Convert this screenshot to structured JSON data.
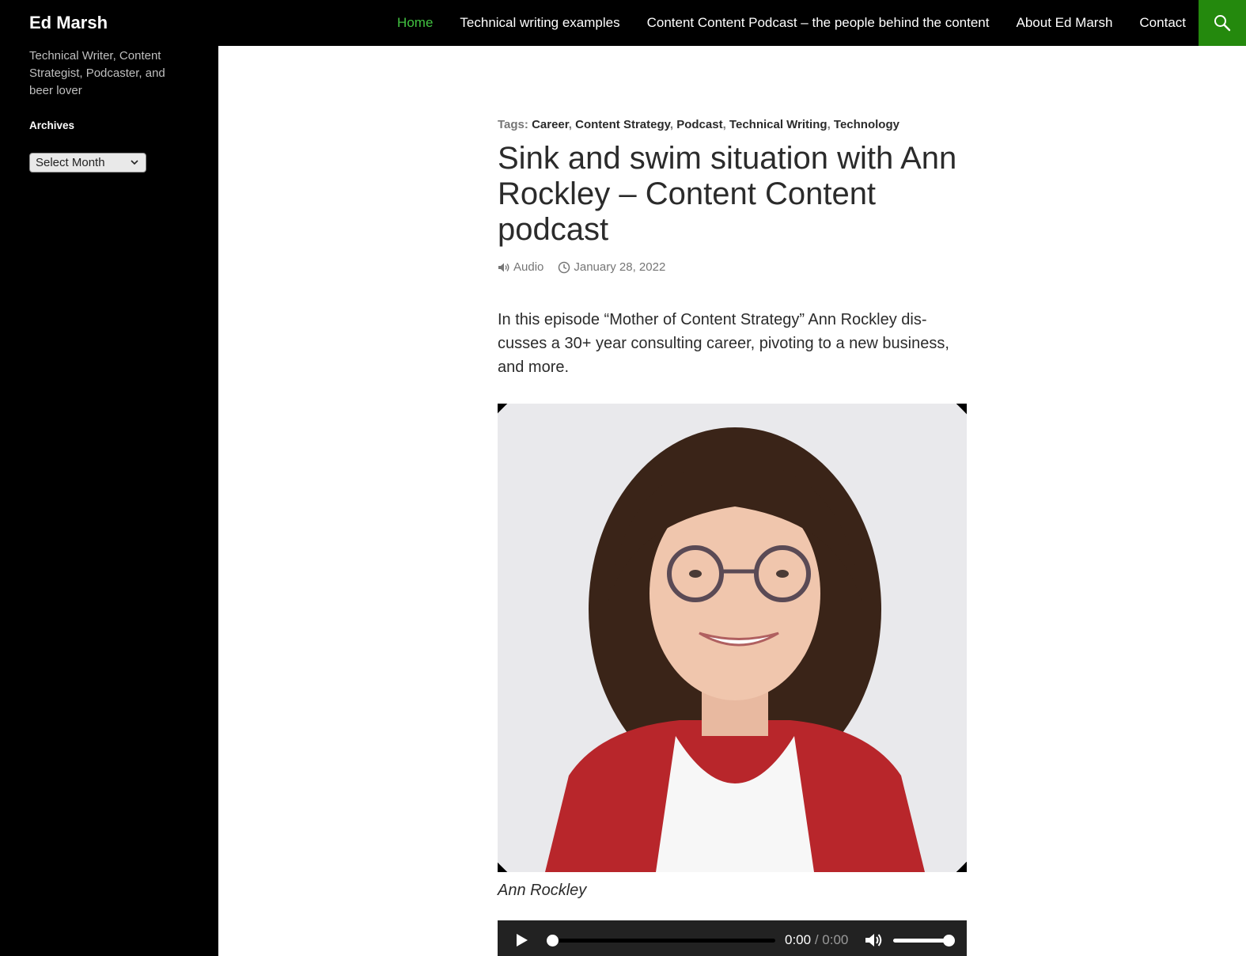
{
  "header": {
    "site_title": "Ed Marsh",
    "nav": [
      {
        "label": "Home",
        "active": true
      },
      {
        "label": "Technical writing examples",
        "active": false
      },
      {
        "label": "Content Content Podcast – the people behind the content",
        "active": false
      },
      {
        "label": "About Ed Marsh",
        "active": false
      },
      {
        "label": "Contact",
        "active": false
      }
    ],
    "search_icon": "search-icon",
    "accent_color": "#24890d",
    "active_link_color": "#41c140"
  },
  "sidebar": {
    "description": "Technical Writer, Content Strategist, Podcaster, and beer lover",
    "archives_title": "Archives",
    "archives_select": "Select Month"
  },
  "post": {
    "tags_label": "Tags:",
    "tags": [
      "Career",
      "Content Strategy",
      "Podcast",
      "Technical Writing",
      "Technology"
    ],
    "title": "Sink and swim situation with Ann Rockley – Content Content podcast",
    "format": "Audio",
    "date": "January 28, 2022",
    "intro": "In this episode “Mother of Content Strategy” Ann Rockley dis­cusses a 30+ year consulting career, pivoting to a new business, and more.",
    "caption": "Ann Rockley"
  },
  "player": {
    "current_time": "0:00",
    "separator": "/",
    "duration": "0:00",
    "progress": 0,
    "volume": 1.0
  }
}
